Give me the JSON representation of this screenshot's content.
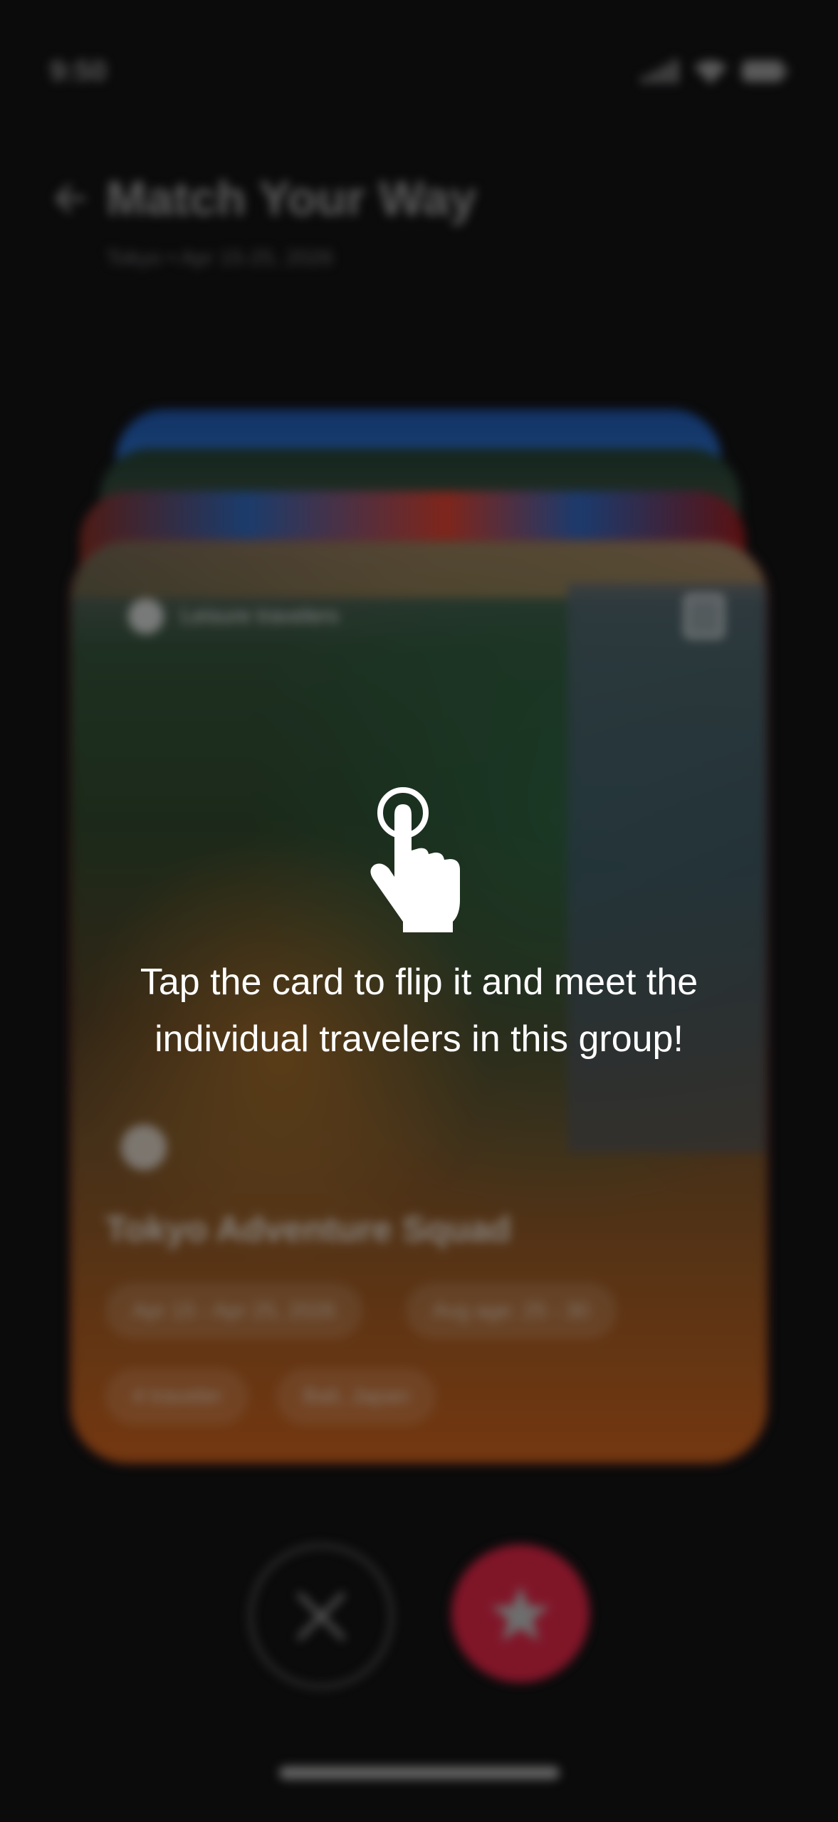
{
  "status_bar": {
    "time": "9:50",
    "icons": [
      "signal-icon",
      "wifi-icon",
      "battery-icon"
    ]
  },
  "header": {
    "back_icon": "back-arrow-icon",
    "title": "Match Your Way",
    "subtitle": "Tokyo • Apr 15-25, 2026"
  },
  "card": {
    "tag_label": "Leisure travelers",
    "flip_icon": "flip-card-icon",
    "title": "Tokyo Adventure Squad",
    "chips": {
      "dates": "Apr 15 - Apr 25, 2026",
      "age": "Avg age: 25 - 30",
      "travelers": "4 traveler",
      "location": "Bali, Japan"
    }
  },
  "actions": {
    "skip_icon": "close-icon",
    "like_icon": "star-icon"
  },
  "coach": {
    "icon": "tap-hand-icon",
    "message": "Tap the card to flip it and meet the individual travelers in this group!"
  },
  "colors": {
    "accent": "#c4223e",
    "background": "#111112",
    "overlay_text": "#ffffff"
  }
}
